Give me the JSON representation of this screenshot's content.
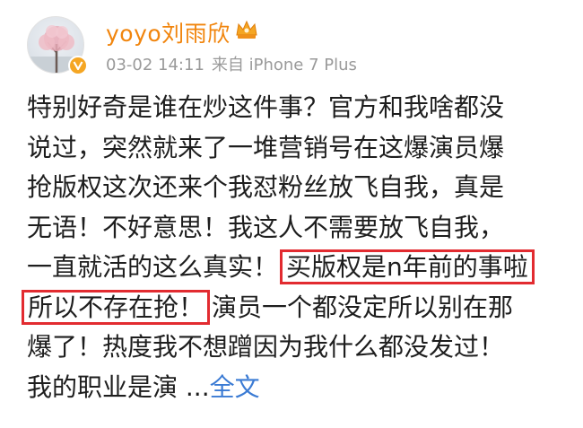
{
  "user": {
    "name": "yoyo刘雨欣",
    "timestamp": "03-02 14:11",
    "source": "来自 iPhone 7 Plus"
  },
  "post": {
    "lines": [
      "特别好奇是谁在炒这件事？官方和我啥都没",
      "说过，突然就来了一堆营销号在这爆演员爆",
      "抢版权这次还来个我怼粉丝放飞自我，真是",
      "无语！不好意思！我这人不需要放飞自我，"
    ],
    "line5_plain": "一直就活的这么真实！",
    "line5_highlight": "买版权是n年前的事啦",
    "line6_highlight": "所以不存在抢！",
    "line6_plain": "演员一个都没定所以别在那",
    "line7": "爆了！热度我不想蹭因为我什么都没发过！",
    "line8": "我的职业是演 ...",
    "more_label": "全文"
  },
  "colors": {
    "username": "#f1850d",
    "highlight_border": "#e22b30",
    "link": "#3b7bd4",
    "meta": "#9a9a9a"
  },
  "icons": {
    "verified": "verified-badge-icon",
    "crown": "vip-crown-icon"
  }
}
